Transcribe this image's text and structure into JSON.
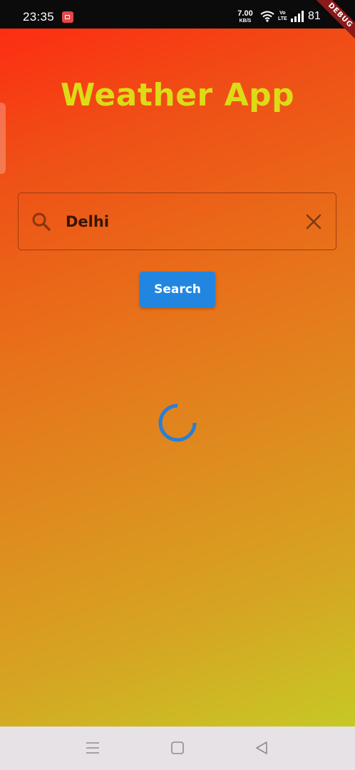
{
  "status_bar": {
    "time": "23:35",
    "net_speed_value": "7.00",
    "net_speed_unit": "KB/S",
    "volte_top": "Vo",
    "volte_bottom": "LTE",
    "battery": "81",
    "icons": [
      "screen-record-icon",
      "wifi-icon",
      "signal-icon"
    ]
  },
  "debug_banner": "DEBUG",
  "app": {
    "title": "Weather App",
    "title_color": "#dcdc16",
    "search": {
      "value": "Delhi",
      "icon": "search-icon",
      "clear_icon": "close-icon"
    },
    "search_button_label": "Search",
    "button_color": "#2286e0",
    "loading": true
  },
  "nav_bar": {
    "icons": [
      "menu-icon",
      "home-icon",
      "back-icon"
    ]
  }
}
